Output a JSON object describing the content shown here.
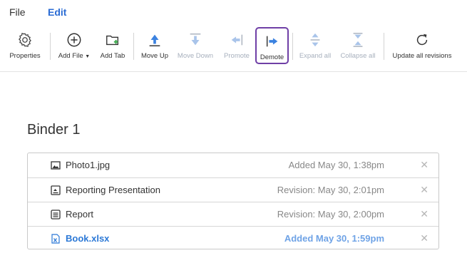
{
  "menu": {
    "file": "File",
    "edit": "Edit"
  },
  "toolbar": {
    "properties": "Properties",
    "add_file": "Add File",
    "add_tab": "Add Tab",
    "move_up": "Move Up",
    "move_down": "Move Down",
    "promote": "Promote",
    "demote": "Demote",
    "expand_all": "Expand all",
    "collapse_all": "Collapse all",
    "update_all": "Update all revisions"
  },
  "binder": {
    "title": "Binder 1",
    "items": [
      {
        "name": "Photo1.jpg",
        "status": "Added May 30, 1:38pm",
        "icon": "image-file-icon"
      },
      {
        "name": "Reporting Presentation",
        "status": "Revision: May 30, 2:01pm",
        "icon": "presentation-file-icon"
      },
      {
        "name": "Report",
        "status": "Revision: May 30, 2:00pm",
        "icon": "document-file-icon"
      },
      {
        "name": "Book.xlsx",
        "status": "Added May 30, 1:59pm",
        "icon": "spreadsheet-file-icon"
      }
    ],
    "remove_symbol": "✕"
  },
  "colors": {
    "accent": "#2b78d6",
    "selected_border": "#6f3fa6",
    "disabled": "#a7b0bd",
    "add_tab_plus": "#3aa84a"
  }
}
